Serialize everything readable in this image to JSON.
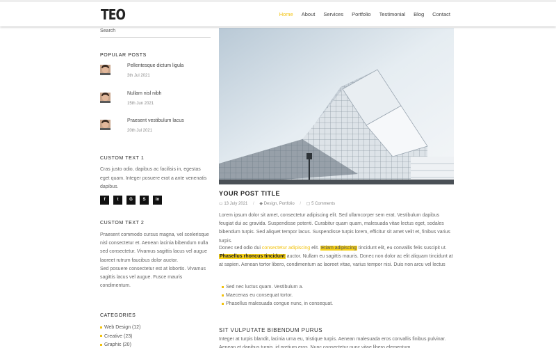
{
  "header": {
    "logo": "TEO",
    "nav": [
      "Home",
      "About",
      "Services",
      "Portfolio",
      "Testimonial",
      "Blog",
      "Contact"
    ],
    "active": "Home"
  },
  "sidebar": {
    "search_placeholder": "Search",
    "popular_heading": "POPULAR POSTS",
    "popular_posts": [
      {
        "title": "Pellentesque dictum ligula",
        "date": "3th Jul 2021"
      },
      {
        "title": "Nullam nisl nibh",
        "date": "15th Jun 2021"
      },
      {
        "title": "Praesent vestibulum lacus",
        "date": "20th Jul 2021"
      }
    ],
    "custom1_heading": "CUSTOM TEXT 1",
    "custom1_text": "Cras justo odio, dapibus ac facilisis in, egestas eget quam. Integer posuere erat a ante venenatis dapibus.",
    "social": [
      "f",
      "t",
      "G",
      "S",
      "in"
    ],
    "custom2_heading": "CUSTOM TEXT 2",
    "custom2_text_1": "Praesent commodo cursus magna, vel scelerisque nisl consectetur et. Aenean lacinia bibendum nulla sed consectetur. Vivamus sagittis lacus vel augue laoreet rutrum faucibus dolor auctor.",
    "custom2_text_2": "Sed posuere consectetur est at lobortis. Vivamus sagittis lacus vel augue. Fusce mauris condimentum.",
    "categories_heading": "CATEGORIES",
    "categories": [
      "Web Design (12)",
      "Creative (23)",
      "Graphic (20)"
    ]
  },
  "post": {
    "title": "YOUR POST TITLE",
    "date": "13 July 2021",
    "tags": "Design, Portfolio",
    "comments": "5 Comments",
    "para1": "Lorem ipsum dolor sit amet, consectetur adipiscing elit. Sed ullamcorper sem erat. Vestibulum dapibus feugiat dui ac gravida. Suspendisse potenti. Curabitur quam quam, malesuada vitae lectus eget, sodales bibendum turpis. Sed aliquet tempor lacus. Suspendisse turpis lorem, efficitur sit amet velit et, finibus varius turpis.",
    "p2_a": "Donec sed odio dui ",
    "p2_link": "consectetur adipiscing",
    "p2_b": " elit. ",
    "p2_hl": "Etiam adipiscing",
    "p2_c": " tincidunt elit, eu convallis felis suscipit ut. ",
    "p2_bold": "Phasellus rhoncus tincidunt",
    "p2_d": " auctor. Nullam eu sagittis mauris. Donec non dolor ac elit aliquam tincidunt at at sapien. Aenean tortor libero, condimentum ac laoreet vitae, varius tempor nisi. Duis non arcu vel lectus",
    "bullets": [
      "Sed nec luctus quam. Vestibulum a.",
      "Maecenas eu consequat tortor.",
      "Phasellus malesuada congue nunc, in consequat."
    ],
    "section2_heading": "SIT VULPUTATE BIBENDUM PURUS",
    "section2_text": "Integer at turpis blandit, lacinia urna eu, tristique turpis. Aenean malesuada eros convallis finibus pulvinar. Aenean et dapibus turpis, id pretium eros. Nunc consectetur nunc vitae libero elementum"
  },
  "colors": {
    "accent": "#f2c20c"
  }
}
